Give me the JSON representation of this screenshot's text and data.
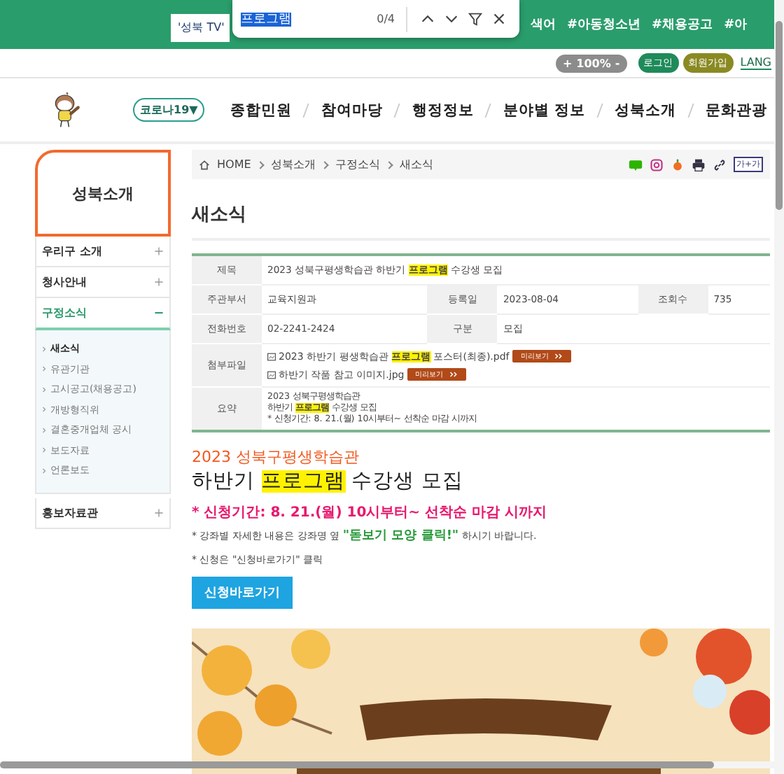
{
  "find_bar": {
    "query": "프로그램",
    "count": "0/4"
  },
  "top_bar": {
    "search_value": "'성북 TV'",
    "hashtags": [
      "색어",
      "#아동청소년",
      "#채용공고",
      "#아"
    ]
  },
  "utility": {
    "zoom_in": "+",
    "zoom_level": "100%",
    "zoom_out": "-",
    "login": "로그인",
    "signup": "회원가입",
    "language": "LANG"
  },
  "nav": {
    "covid_button": "코로나19▼",
    "items": [
      "종합민원",
      "참여마당",
      "행정정보",
      "분야별 정보",
      "성북소개",
      "문화관광"
    ]
  },
  "sidebar": {
    "title": "성북소개",
    "items": [
      {
        "label": "우리구 소개",
        "expanded": false
      },
      {
        "label": "청사안내",
        "expanded": false
      },
      {
        "label": "구정소식",
        "expanded": true,
        "children": [
          {
            "label": "새소식",
            "selected": true
          },
          {
            "label": "유관기관",
            "selected": false
          },
          {
            "label": "고시공고(채용공고)",
            "selected": false
          },
          {
            "label": "개방형직위",
            "selected": false
          },
          {
            "label": "결혼중개업체 공시",
            "selected": false
          },
          {
            "label": "보도자료",
            "selected": false
          },
          {
            "label": "언론보도",
            "selected": false
          }
        ]
      },
      {
        "label": "홍보자료관",
        "expanded": false
      }
    ]
  },
  "breadcrumb": [
    "HOME",
    "성북소개",
    "구정소식",
    "새소식"
  ],
  "font_size_button": "가+가",
  "page_title": "새소식",
  "info": {
    "title_label": "제목",
    "title": [
      {
        "text": "2023 성북구평생학습관 하반기 ",
        "highlight": false
      },
      {
        "text": "프로그램",
        "highlight": true
      },
      {
        "text": " 수강생 모집",
        "highlight": false
      }
    ],
    "dept_label": "주관부서",
    "dept": "교육지원과",
    "date_label": "등록일",
    "date": "2023-08-04",
    "views_label": "조회수",
    "views": "735",
    "phone_label": "전화번호",
    "phone": "02-2241-2424",
    "category_label": "구분",
    "category": "모집",
    "files_label": "첨부파일",
    "files": [
      {
        "name": [
          {
            "text": "2023 하반기 평생학습관 ",
            "highlight": false
          },
          {
            "text": "프로그램",
            "highlight": true
          },
          {
            "text": " 포스터(최종).pdf",
            "highlight": false
          }
        ],
        "preview": "미리보기"
      },
      {
        "name": [
          {
            "text": "하반기 작품 참고 이미지.jpg",
            "highlight": false
          }
        ],
        "preview": "미리보기"
      }
    ],
    "summary_label": "요약",
    "summary": [
      [
        {
          "text": "2023 성북구평생학습관",
          "highlight": false
        }
      ],
      [
        {
          "text": "하반기 ",
          "highlight": false
        },
        {
          "text": "프로그램",
          "highlight": true
        },
        {
          "text": " 수강생 모집",
          "highlight": false
        }
      ],
      [
        {
          "text": "* 신청기간: 8. 21.(월) 10시부터~ 선착순 마감 시까지",
          "highlight": false
        }
      ]
    ]
  },
  "article": {
    "subtitle": "2023 성북구평생학습관",
    "title": [
      {
        "text": "하반기 ",
        "highlight": false
      },
      {
        "text": "프로그램",
        "highlight": true
      },
      {
        "text": " 수강생 모집",
        "highlight": false
      }
    ],
    "period": "* 신청기간: 8. 21.(월) 10시부터~ 선착순 마감 시까지",
    "notes": [
      [
        {
          "text": "* 강좌별 자세한 내용은 강좌명 옆 ",
          "emphasis": false
        },
        {
          "text": "\"돋보기 모양 클릭!\"",
          "emphasis": true
        },
        {
          "text": " 하시기 바랍니다.",
          "emphasis": false
        }
      ],
      [
        {
          "text": "* 신청은 \"신청바로가기\" 클릭",
          "emphasis": false
        }
      ]
    ],
    "apply_button": "신청바로가기"
  }
}
